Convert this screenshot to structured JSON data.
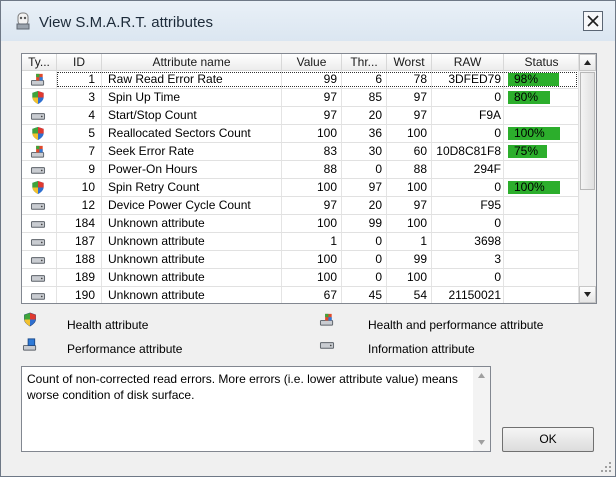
{
  "window": {
    "title": "View S.M.A.R.T. attributes"
  },
  "columns": [
    "Ty...",
    "ID",
    "Attribute name",
    "Value",
    "Thr...",
    "Worst",
    "RAW",
    "Status"
  ],
  "rows": [
    {
      "type": "performance",
      "id": "1",
      "name": "Raw Read Error Rate",
      "value": "99",
      "thr": "6",
      "worst": "78",
      "raw": "3DFED79",
      "status": "98%",
      "status_level": 0.98,
      "selected": true
    },
    {
      "type": "health",
      "id": "3",
      "name": "Spin Up Time",
      "value": "97",
      "thr": "85",
      "worst": "97",
      "raw": "0",
      "status": "80%",
      "status_level": 0.8
    },
    {
      "type": "info",
      "id": "4",
      "name": "Start/Stop Count",
      "value": "97",
      "thr": "20",
      "worst": "97",
      "raw": "F9A",
      "status": "",
      "status_level": null
    },
    {
      "type": "health",
      "id": "5",
      "name": "Reallocated Sectors Count",
      "value": "100",
      "thr": "36",
      "worst": "100",
      "raw": "0",
      "status": "100%",
      "status_level": 1.0
    },
    {
      "type": "performance",
      "id": "7",
      "name": "Seek Error Rate",
      "value": "83",
      "thr": "30",
      "worst": "60",
      "raw": "10D8C81F8",
      "status": "75%",
      "status_level": 0.75
    },
    {
      "type": "info",
      "id": "9",
      "name": "Power-On Hours",
      "value": "88",
      "thr": "0",
      "worst": "88",
      "raw": "294F",
      "status": "",
      "status_level": null
    },
    {
      "type": "health",
      "id": "10",
      "name": "Spin Retry Count",
      "value": "100",
      "thr": "97",
      "worst": "100",
      "raw": "0",
      "status": "100%",
      "status_level": 1.0
    },
    {
      "type": "info",
      "id": "12",
      "name": "Device Power Cycle Count",
      "value": "97",
      "thr": "20",
      "worst": "97",
      "raw": "F95",
      "status": "",
      "status_level": null
    },
    {
      "type": "info",
      "id": "184",
      "name": "Unknown attribute",
      "value": "100",
      "thr": "99",
      "worst": "100",
      "raw": "0",
      "status": "",
      "status_level": null
    },
    {
      "type": "info",
      "id": "187",
      "name": "Unknown attribute",
      "value": "1",
      "thr": "0",
      "worst": "1",
      "raw": "3698",
      "status": "",
      "status_level": null
    },
    {
      "type": "info",
      "id": "188",
      "name": "Unknown attribute",
      "value": "100",
      "thr": "0",
      "worst": "99",
      "raw": "3",
      "status": "",
      "status_level": null
    },
    {
      "type": "info",
      "id": "189",
      "name": "Unknown attribute",
      "value": "100",
      "thr": "0",
      "worst": "100",
      "raw": "0",
      "status": "",
      "status_level": null
    },
    {
      "type": "info",
      "id": "190",
      "name": "Unknown attribute",
      "value": "67",
      "thr": "45",
      "worst": "54",
      "raw": "21150021",
      "status": "",
      "status_level": null
    }
  ],
  "legend": {
    "health": "Health attribute",
    "performance": "Performance attribute",
    "health_performance": "Health and performance attribute",
    "info": "Information attribute"
  },
  "description": "Count of non-corrected read errors. More errors (i.e. lower attribute value) means worse condition of disk surface.",
  "buttons": {
    "ok": "OK"
  },
  "colors": {
    "status_bar": "#2cae2c",
    "backdrop": "#1f8f2a"
  }
}
